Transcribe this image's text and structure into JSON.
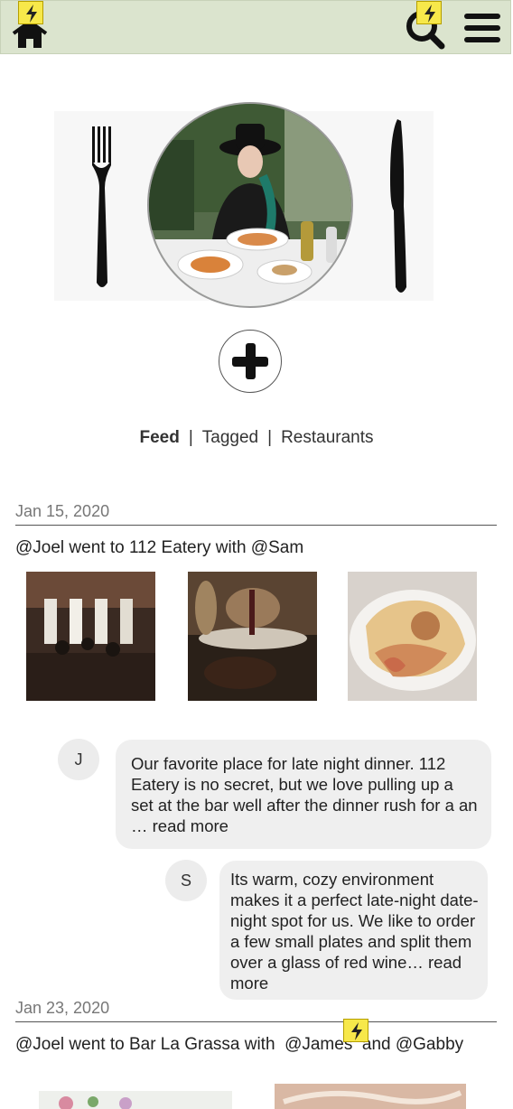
{
  "header": {
    "home_icon": "home-icon",
    "search_icon": "search-icon",
    "menu_icon": "hamburger-menu-icon",
    "bolt_icon": "lightning-bolt-icon",
    "bar_color": "#dbe4ce"
  },
  "profile": {
    "photo_alt": "profile-photo"
  },
  "add_button_icon": "plus-icon",
  "tabs": {
    "feed": "Feed",
    "sep1": "|",
    "tagged": "Tagged",
    "sep2": "|",
    "restaurants": "Restaurants"
  },
  "posts": [
    {
      "date": "Jan 15, 2020",
      "title": "@Joel went to 112 Eatery with @Sam",
      "comments": [
        {
          "initial": "J",
          "text": "Our favorite place for late night dinner. 112 Eatery is no secret, but we love pulling up a set at the bar well after the dinner rush for a an … read more"
        },
        {
          "initial": "S",
          "text": "Its warm, cozy environment makes it a perfect late-night date-night spot for us. We like to order a few small plates and split them over a glass of red wine… read more"
        }
      ]
    },
    {
      "date": "Jan 23, 2020",
      "title": "@Joel went to Bar La Grassa with  @James  and @Gabby"
    }
  ]
}
